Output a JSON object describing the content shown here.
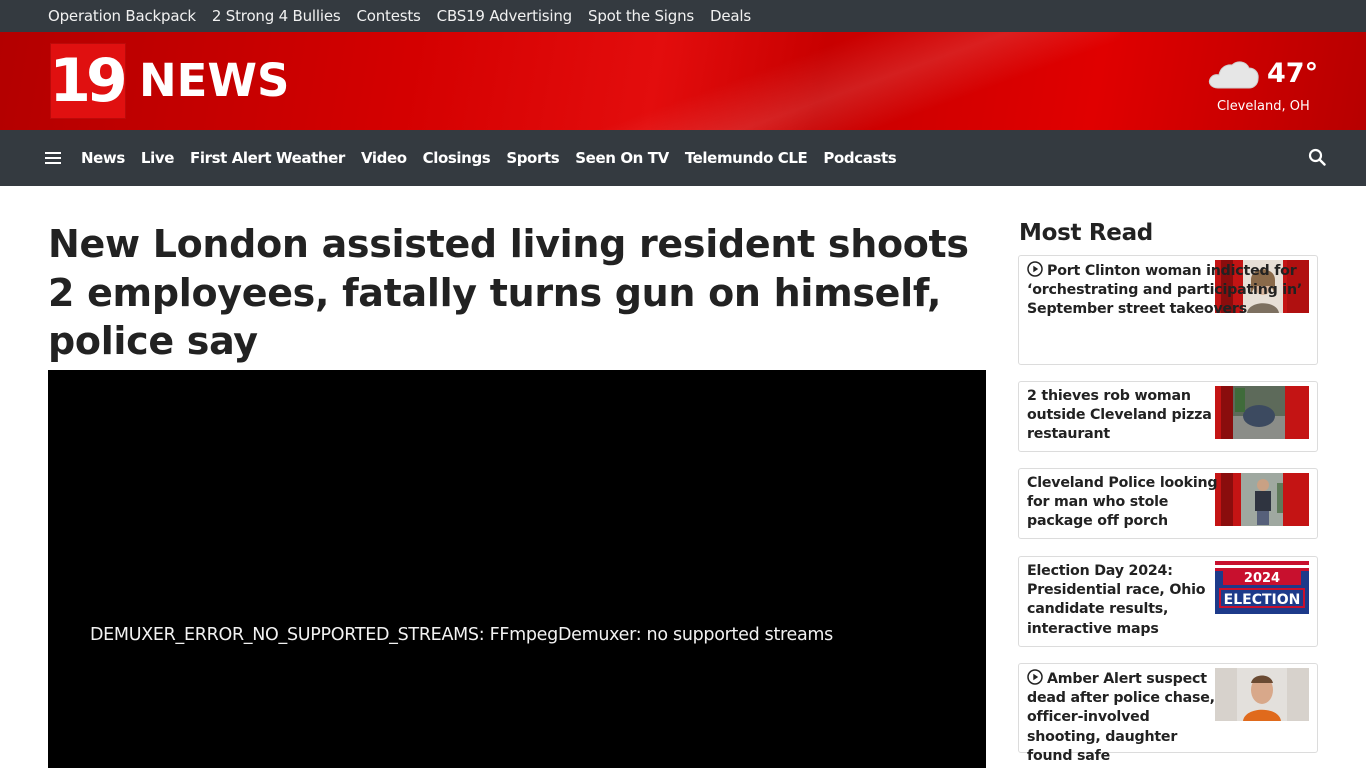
{
  "utility_nav": {
    "items": [
      {
        "label": "Operation Backpack"
      },
      {
        "label": "2 Strong 4 Bullies"
      },
      {
        "label": "Contests"
      },
      {
        "label": "CBS19 Advertising"
      },
      {
        "label": "Spot the Signs"
      },
      {
        "label": "Deals"
      }
    ]
  },
  "brand": {
    "logo_number": "19",
    "logo_word": "NEWS"
  },
  "weather": {
    "icon": "cloud-icon",
    "temperature": "47°",
    "city": "Cleveland, OH"
  },
  "main_nav": {
    "menu_icon": "hamburger-icon",
    "items": [
      {
        "label": "News"
      },
      {
        "label": "Live"
      },
      {
        "label": "First Alert Weather"
      },
      {
        "label": "Video"
      },
      {
        "label": "Closings"
      },
      {
        "label": "Sports"
      },
      {
        "label": "Seen On TV"
      },
      {
        "label": "Telemundo CLE"
      },
      {
        "label": "Podcasts"
      }
    ],
    "search_icon": "search-icon"
  },
  "article": {
    "headline": "New London assisted living resident shoots 2 employees, fatally turns gun on himself, police say",
    "video_error": "DEMUXER_ERROR_NO_SUPPORTED_STREAMS: FFmpegDemuxer: no supported streams"
  },
  "sidebar": {
    "title": "Most Read",
    "stories": [
      {
        "has_video": true,
        "title": "Port Clinton woman indicted for ‘orchestrating and participating in’ September street takeovers"
      },
      {
        "has_video": false,
        "title": "2 thieves rob woman outside Cleveland pizza restaurant"
      },
      {
        "has_video": false,
        "title": "Cleveland Police looking for man who stole package off porch"
      },
      {
        "has_video": false,
        "title": "Election Day 2024: Presidential race, Ohio candidate results, interactive maps",
        "thumb_line1": "2024",
        "thumb_line2": "ELECTION"
      },
      {
        "has_video": true,
        "title": "Amber Alert suspect dead after police chase, officer-involved shooting, daughter found safe"
      }
    ]
  },
  "colors": {
    "brand_red": "#d40000",
    "nav_bg": "#343a40",
    "text": "#222222"
  }
}
